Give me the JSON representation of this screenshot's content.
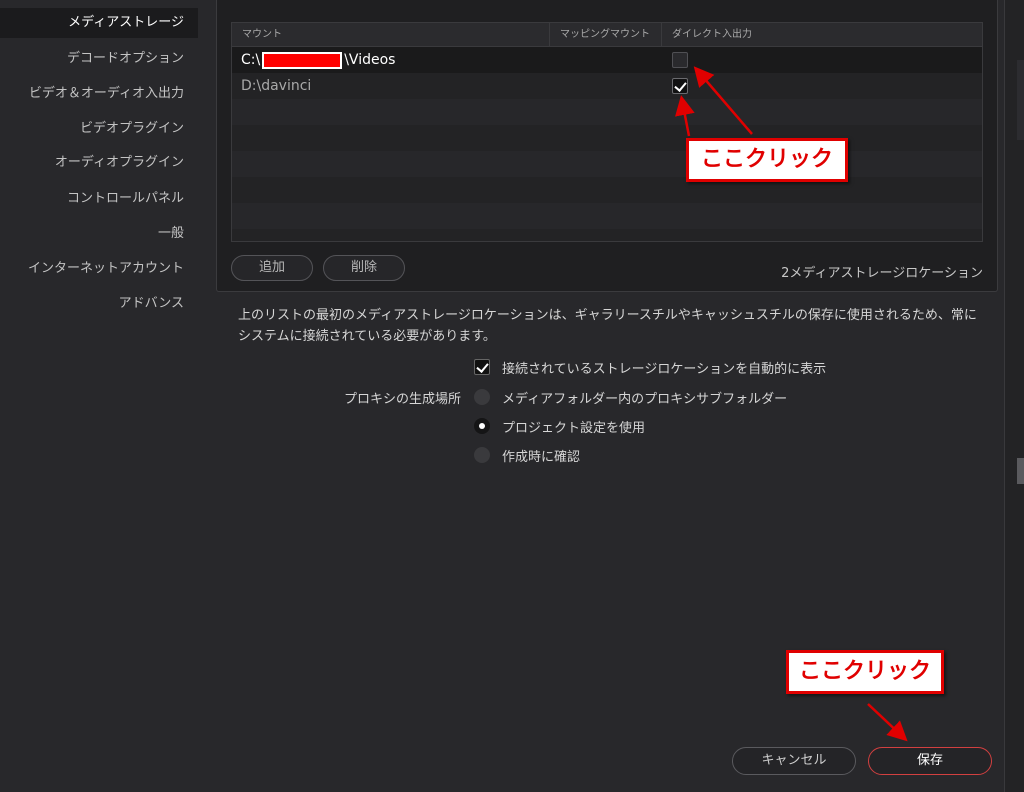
{
  "sidebar": {
    "items": [
      {
        "label": "メディアストレージ",
        "active": true
      },
      {
        "label": "デコードオプション"
      },
      {
        "label": "ビデオ＆オーディオ入出力"
      },
      {
        "label": "ビデオプラグイン"
      },
      {
        "label": "オーディオプラグイン"
      },
      {
        "label": "コントロールパネル"
      },
      {
        "label": "一般"
      },
      {
        "label": "インターネットアカウント"
      },
      {
        "label": "アドバンス"
      }
    ]
  },
  "storage": {
    "columns": [
      "マウント",
      "マッピングマウント",
      "ダイレクト入出力"
    ],
    "rows": [
      {
        "path_prefix": "C:\\",
        "path_suffix": "\\Videos",
        "redacted": true,
        "direct_io": false
      },
      {
        "path_prefix": "D:\\davinci",
        "path_suffix": "",
        "redacted": false,
        "direct_io": true
      }
    ],
    "add_label": "追加",
    "delete_label": "削除",
    "count_label": "2メディアストレージロケーション"
  },
  "info_text": "上のリストの最初のメディアストレージロケーションは、ギャラリースチルやキャッシュスチルの保存に使用されるため、常にシステムに接続されている必要があります。",
  "auto_show": {
    "label": "接続されているストレージロケーションを自動的に表示",
    "checked": true
  },
  "proxy": {
    "label": "プロキシの生成場所",
    "options": [
      {
        "label": "メディアフォルダー内のプロキシサブフォルダー",
        "selected": false
      },
      {
        "label": "プロジェクト設定を使用",
        "selected": true
      },
      {
        "label": "作成時に確認",
        "selected": false
      }
    ]
  },
  "footer": {
    "cancel_label": "キャンセル",
    "save_label": "保存"
  },
  "annotations": {
    "callout_1": "ここクリック",
    "callout_2": "ここクリック",
    "color": "#e00000"
  }
}
